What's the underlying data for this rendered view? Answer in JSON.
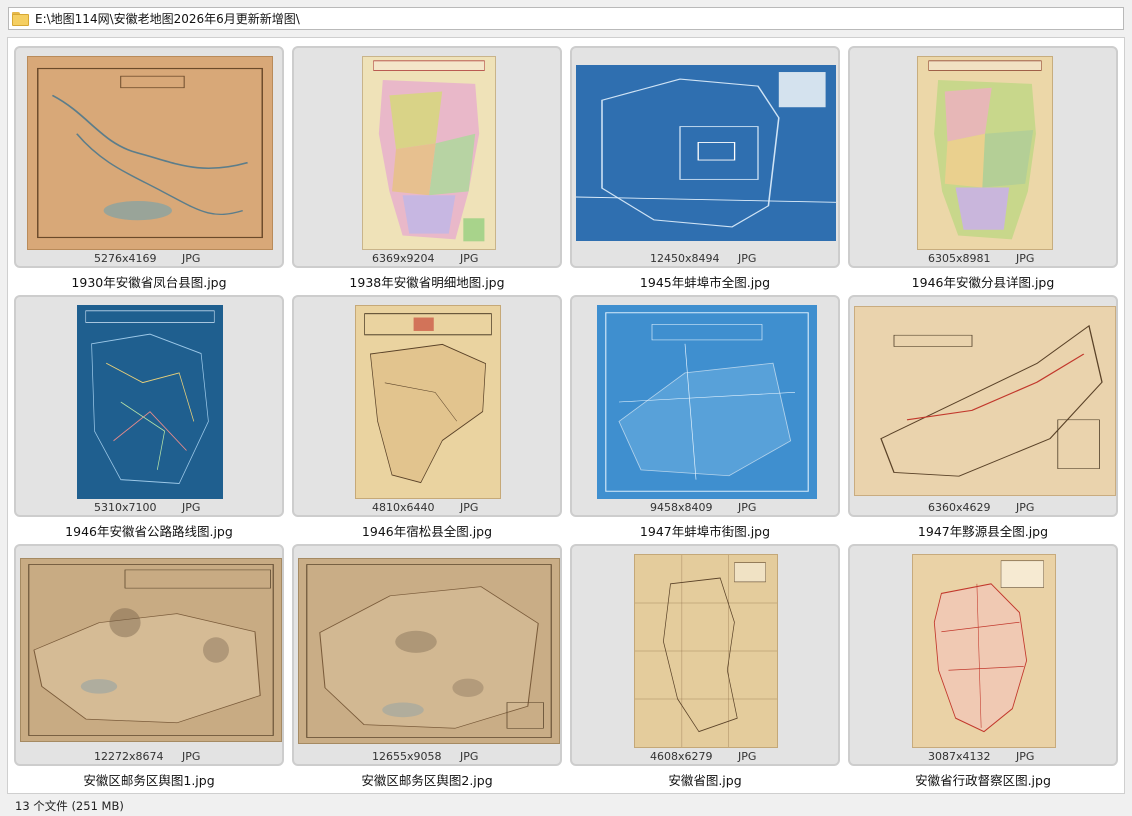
{
  "address_bar": {
    "path": "E:\\地图114网\\安徽老地图2026年6月更新新增图\\"
  },
  "items": [
    {
      "name": "1930年安徽省凤台县图.jpg",
      "dims": "5276x4169",
      "type": "JPG",
      "thumb_bg": "#d9a878",
      "thumb_kind": "tan-river"
    },
    {
      "name": "1938年安徽省明细地图.jpg",
      "dims": "6369x9204",
      "type": "JPG",
      "thumb_bg": "#efe2b8",
      "thumb_kind": "colored"
    },
    {
      "name": "1945年蚌埠市全图.jpg",
      "dims": "12450x8494",
      "type": "JPG",
      "thumb_bg": "#2f6fb0",
      "thumb_kind": "blueprint"
    },
    {
      "name": "1946年安徽分县详图.jpg",
      "dims": "6305x8981",
      "type": "JPG",
      "thumb_bg": "#ecd7a8",
      "thumb_kind": "colored"
    },
    {
      "name": "1946年安徽省公路路线图.jpg",
      "dims": "5310x7100",
      "type": "JPG",
      "thumb_bg": "#1f5f8f",
      "thumb_kind": "blueprint-dark"
    },
    {
      "name": "1946年宿松县全图.jpg",
      "dims": "4810x6440",
      "type": "JPG",
      "thumb_bg": "#ead3a0",
      "thumb_kind": "tan"
    },
    {
      "name": "1947年蚌埠市街图.jpg",
      "dims": "9458x8409",
      "type": "JPG",
      "thumb_bg": "#3f8fcf",
      "thumb_kind": "blueprint"
    },
    {
      "name": "1947年黟源县全图.jpg",
      "dims": "6360x4629",
      "type": "JPG",
      "thumb_bg": "#ead3ad",
      "thumb_kind": "tan"
    },
    {
      "name": "安徽区邮务区舆图1.jpg",
      "dims": "12272x8674",
      "type": "JPG",
      "thumb_bg": "#c8ab83",
      "thumb_kind": "stained"
    },
    {
      "name": "安徽区邮务区舆图2.jpg",
      "dims": "12655x9058",
      "type": "JPG",
      "thumb_bg": "#c9ad86",
      "thumb_kind": "stained"
    },
    {
      "name": "安徽省图.jpg",
      "dims": "4608x6279",
      "type": "JPG",
      "thumb_bg": "#e4cc9c",
      "thumb_kind": "tan"
    },
    {
      "name": "安徽省行政督察区图.jpg",
      "dims": "3087x4132",
      "type": "JPG",
      "thumb_bg": "#ead2a6",
      "thumb_kind": "redmap"
    }
  ],
  "status_bar": {
    "text": "13 个文件 (251 MB)"
  }
}
